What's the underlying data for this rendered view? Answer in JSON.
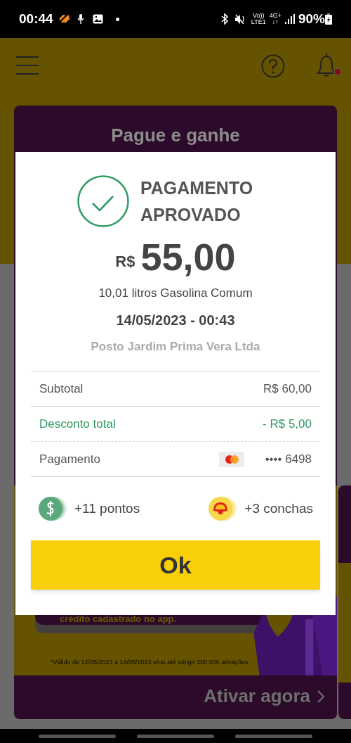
{
  "status_bar": {
    "time": "00:44",
    "volte_top": "Vo))",
    "volte_bottom": "LTE1",
    "data_top": "4G+",
    "data_bottom": "↓↑",
    "battery": "90%"
  },
  "promo_card": {
    "title": "Pague e ganhe",
    "text": "crédito cadastrado no app.",
    "footnote": "*Válido de 12/05/2023 a 14/05/2023 e/ou até atingir 200.000 ativações.",
    "action": "Ativar agora"
  },
  "dialog": {
    "status": "PAGAMENTO APROVADO",
    "currency": "R$",
    "amount": "55,00",
    "description": "10,01 litros Gasolina Comum",
    "datetime": "14/05/2023 - 00:43",
    "station": "Posto Jardim Prima Vera Ltda",
    "rows": [
      {
        "kind": "plain",
        "label": "Subtotal",
        "value": "R$ 60,00"
      },
      {
        "kind": "discount",
        "label": "Desconto total",
        "value": "- R$ 5,00"
      },
      {
        "kind": "card",
        "label": "Pagamento",
        "value": "•••• 6498"
      }
    ],
    "rewards": [
      {
        "kind": "money",
        "text": "+11 pontos"
      },
      {
        "kind": "shell",
        "text": "+3 conchas"
      }
    ],
    "button": "Ok"
  }
}
